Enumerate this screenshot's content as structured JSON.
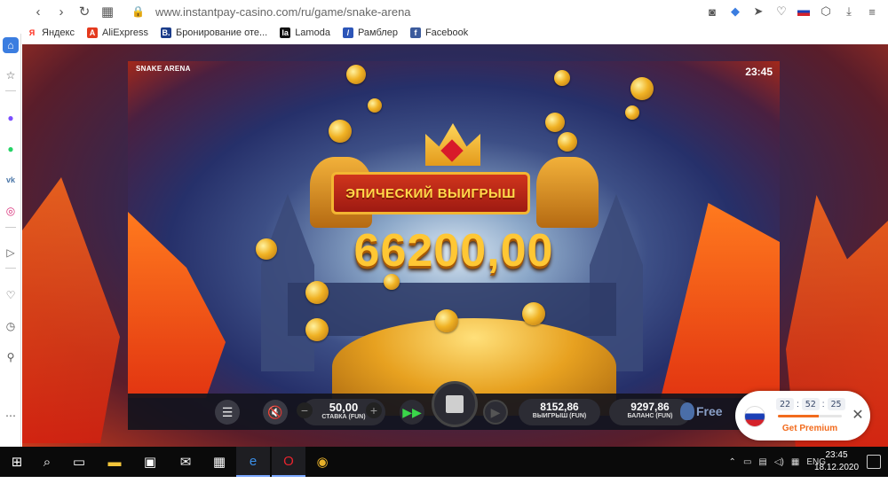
{
  "browser": {
    "url": "www.instantpay-casino.com/ru/game/snake-arena",
    "bookmarks": [
      {
        "label": "Яндекс",
        "icon": "Я",
        "color": "#ff2a1a"
      },
      {
        "label": "AliExpress",
        "icon": "A",
        "color": "#e43a1e"
      },
      {
        "label": "Бронирование оте...",
        "icon": "B.",
        "color": "#1b3c8a"
      },
      {
        "label": "Lamoda",
        "icon": "la",
        "color": "#111111"
      },
      {
        "label": "Рамблер",
        "icon": "/",
        "color": "#2c55b8"
      },
      {
        "label": "Facebook",
        "icon": "f",
        "color": "#3b5b9c"
      }
    ]
  },
  "game": {
    "title": "SNAKE ARENA",
    "clock": "23:45",
    "win_banner": "ЭПИЧЕСКИЙ ВЫИГРЫШ",
    "big_win": "66200,00",
    "bet": {
      "value": "50,00",
      "label": "СТАВКА (FUN)"
    },
    "win": {
      "value": "8152,86",
      "label": "ВЫИГРЫШ (FUN)"
    },
    "balance": {
      "value": "9297,86",
      "label": "БАЛАНС (FUN)"
    },
    "free_label": "Free"
  },
  "premium": {
    "timer": [
      "22",
      "52",
      "25"
    ],
    "label": "Get Premium",
    "progress": 0.64,
    "accent": "#f26b1d"
  },
  "taskbar": {
    "lang": "ENG",
    "time": "23:45",
    "date": "18.12.2020"
  }
}
